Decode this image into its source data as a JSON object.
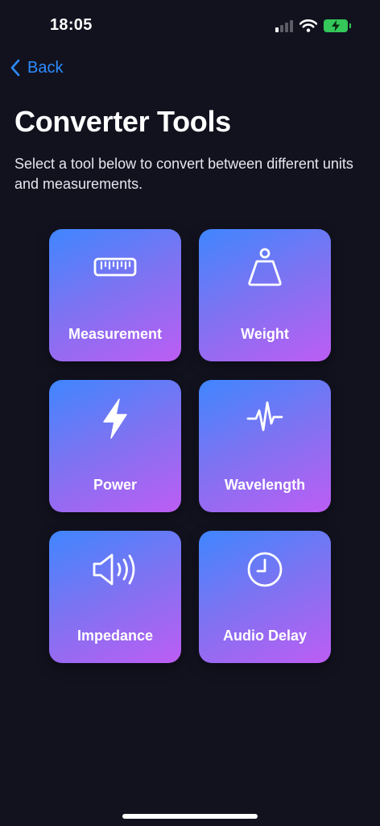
{
  "status_bar": {
    "time": "18:05"
  },
  "nav": {
    "back_label": "Back"
  },
  "header": {
    "title": "Converter Tools",
    "subtitle": "Select a tool below to convert between different units and measurements."
  },
  "tools": [
    {
      "label": "Measurement",
      "icon": "ruler-icon"
    },
    {
      "label": "Weight",
      "icon": "weight-icon"
    },
    {
      "label": "Power",
      "icon": "bolt-icon"
    },
    {
      "label": "Wavelength",
      "icon": "waveform-icon"
    },
    {
      "label": "Impedance",
      "icon": "speaker-icon"
    },
    {
      "label": "Audio Delay",
      "icon": "clock-icon"
    }
  ],
  "colors": {
    "background": "#12121f",
    "accent": "#2d8cff",
    "card_gradient_start": "#3f86ff",
    "card_gradient_end": "#bd5df3",
    "battery": "#34c759"
  }
}
